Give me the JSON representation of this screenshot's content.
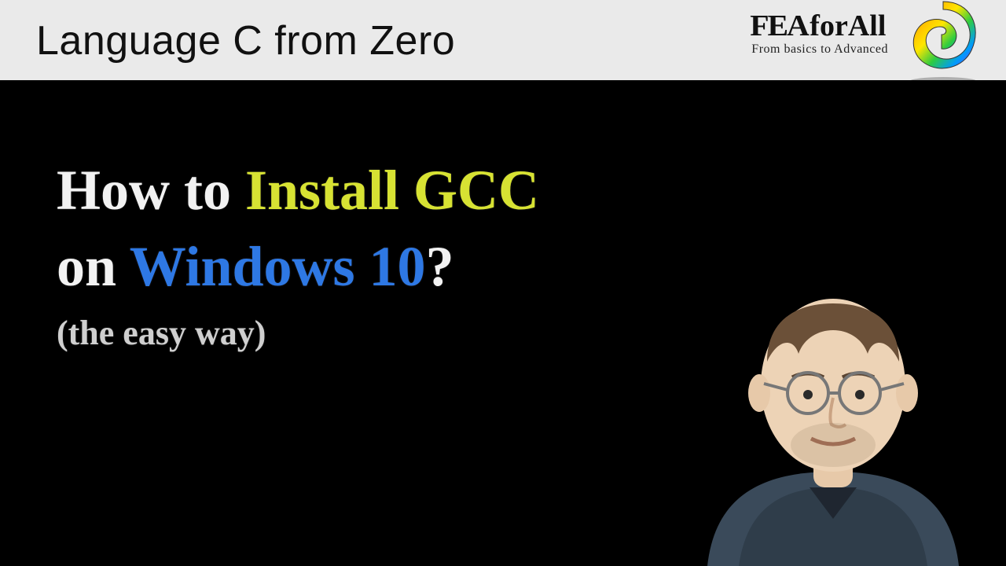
{
  "header": {
    "course_title": "Language C from Zero",
    "brand_fea": "FEA",
    "brand_forall": "forAll",
    "brand_tagline": "From basics to Advanced"
  },
  "title": {
    "line1_part1": "How to ",
    "line1_part2": "Install GCC",
    "line2_part1": "on ",
    "line2_part2": "Windows 10",
    "line2_part3": "?",
    "subtitle": "(the easy way)"
  },
  "colors": {
    "bg": "#000000",
    "header_bg": "#eaeaea",
    "chalk_white": "#f2f2f2",
    "chalk_yellow": "#d7e233",
    "chalk_blue": "#2e78e4"
  }
}
